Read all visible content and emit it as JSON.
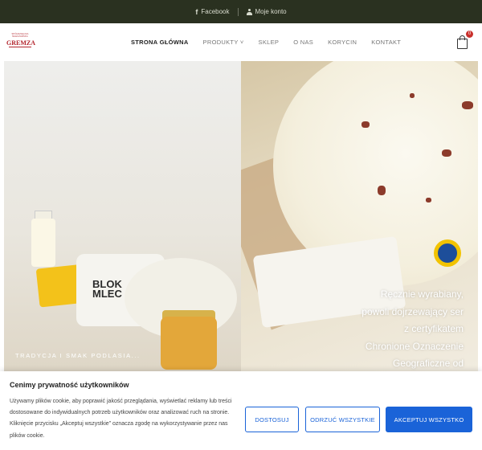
{
  "topbar": {
    "facebook_label": "Facebook",
    "account_label": "Moje konto",
    "background": "#2a3120"
  },
  "logo": {
    "arc_text": "SPÓŁDZIELNIA MLECZARSKA",
    "name": "GREMZA"
  },
  "nav": {
    "items": [
      {
        "label": "STRONA GŁÓWNA",
        "active": true
      },
      {
        "label": "PRODUKTY ˅",
        "active": false
      },
      {
        "label": "SKLEP",
        "active": false
      },
      {
        "label": "O NAS",
        "active": false
      },
      {
        "label": "KORYCIN",
        "active": false
      },
      {
        "label": "KONTAKT",
        "active": false
      }
    ]
  },
  "cart": {
    "count": "0",
    "icon": "shopping-bag-icon"
  },
  "hero": {
    "left_caption": "TRADYCJA I SMAK PODLASIA...",
    "left_product_label": "BLOK MLEC",
    "right_text": [
      "Ręcznie wyrabiany,",
      "powoli dojrzewający ser",
      "z certyfikatem",
      "Chronione Oznaczenie",
      "Geograficzne od"
    ]
  },
  "cookie": {
    "title": "Cenimy prywatność użytkowników",
    "text": "Używamy plików cookie, aby poprawić jakość przeglądania, wyświetlać reklamy lub treści dostosowane do indywidualnych potrzeb użytkowników oraz analizować ruch na stronie. Kliknięcie przycisku „Akceptuj wszystkie” oznacza zgodę na wykorzystywanie przez nas plików cookie.",
    "btn_customize": "DOSTOSUJ",
    "btn_reject": "ODRZUĆ WSZYSTKIE",
    "btn_accept": "AKCEPTUJ WSZYSTKO",
    "accent": "#1a63d8"
  }
}
